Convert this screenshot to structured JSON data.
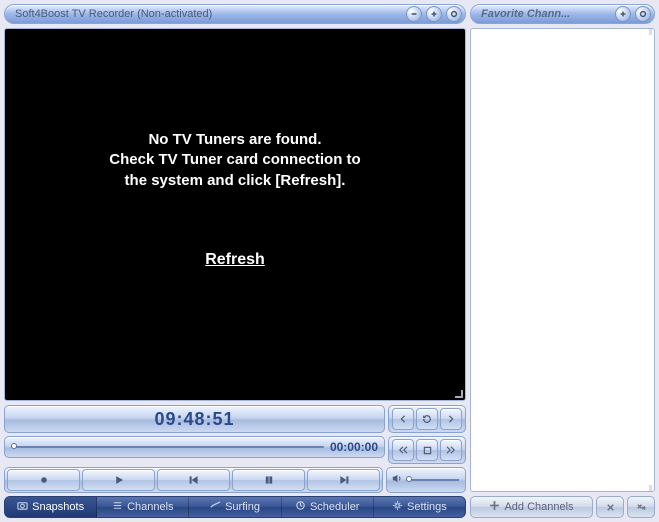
{
  "main": {
    "title": "Soft4Boost TV Recorder (Non-activated)",
    "message_line1": "No TV Tuners are found.",
    "message_line2": "Check TV Tuner card connection to",
    "message_line3": "the system and click [Refresh].",
    "refresh_label": "Refresh"
  },
  "controls": {
    "clock": "09:48:51",
    "seek_time": "00:00:00"
  },
  "tabs": {
    "snapshots": "Snapshots",
    "channels": "Channels",
    "surfing": "Surfing",
    "scheduler": "Scheduler",
    "settings": "Settings"
  },
  "side": {
    "title": "Favorite Chann...",
    "add_channels": "Add Channels"
  }
}
